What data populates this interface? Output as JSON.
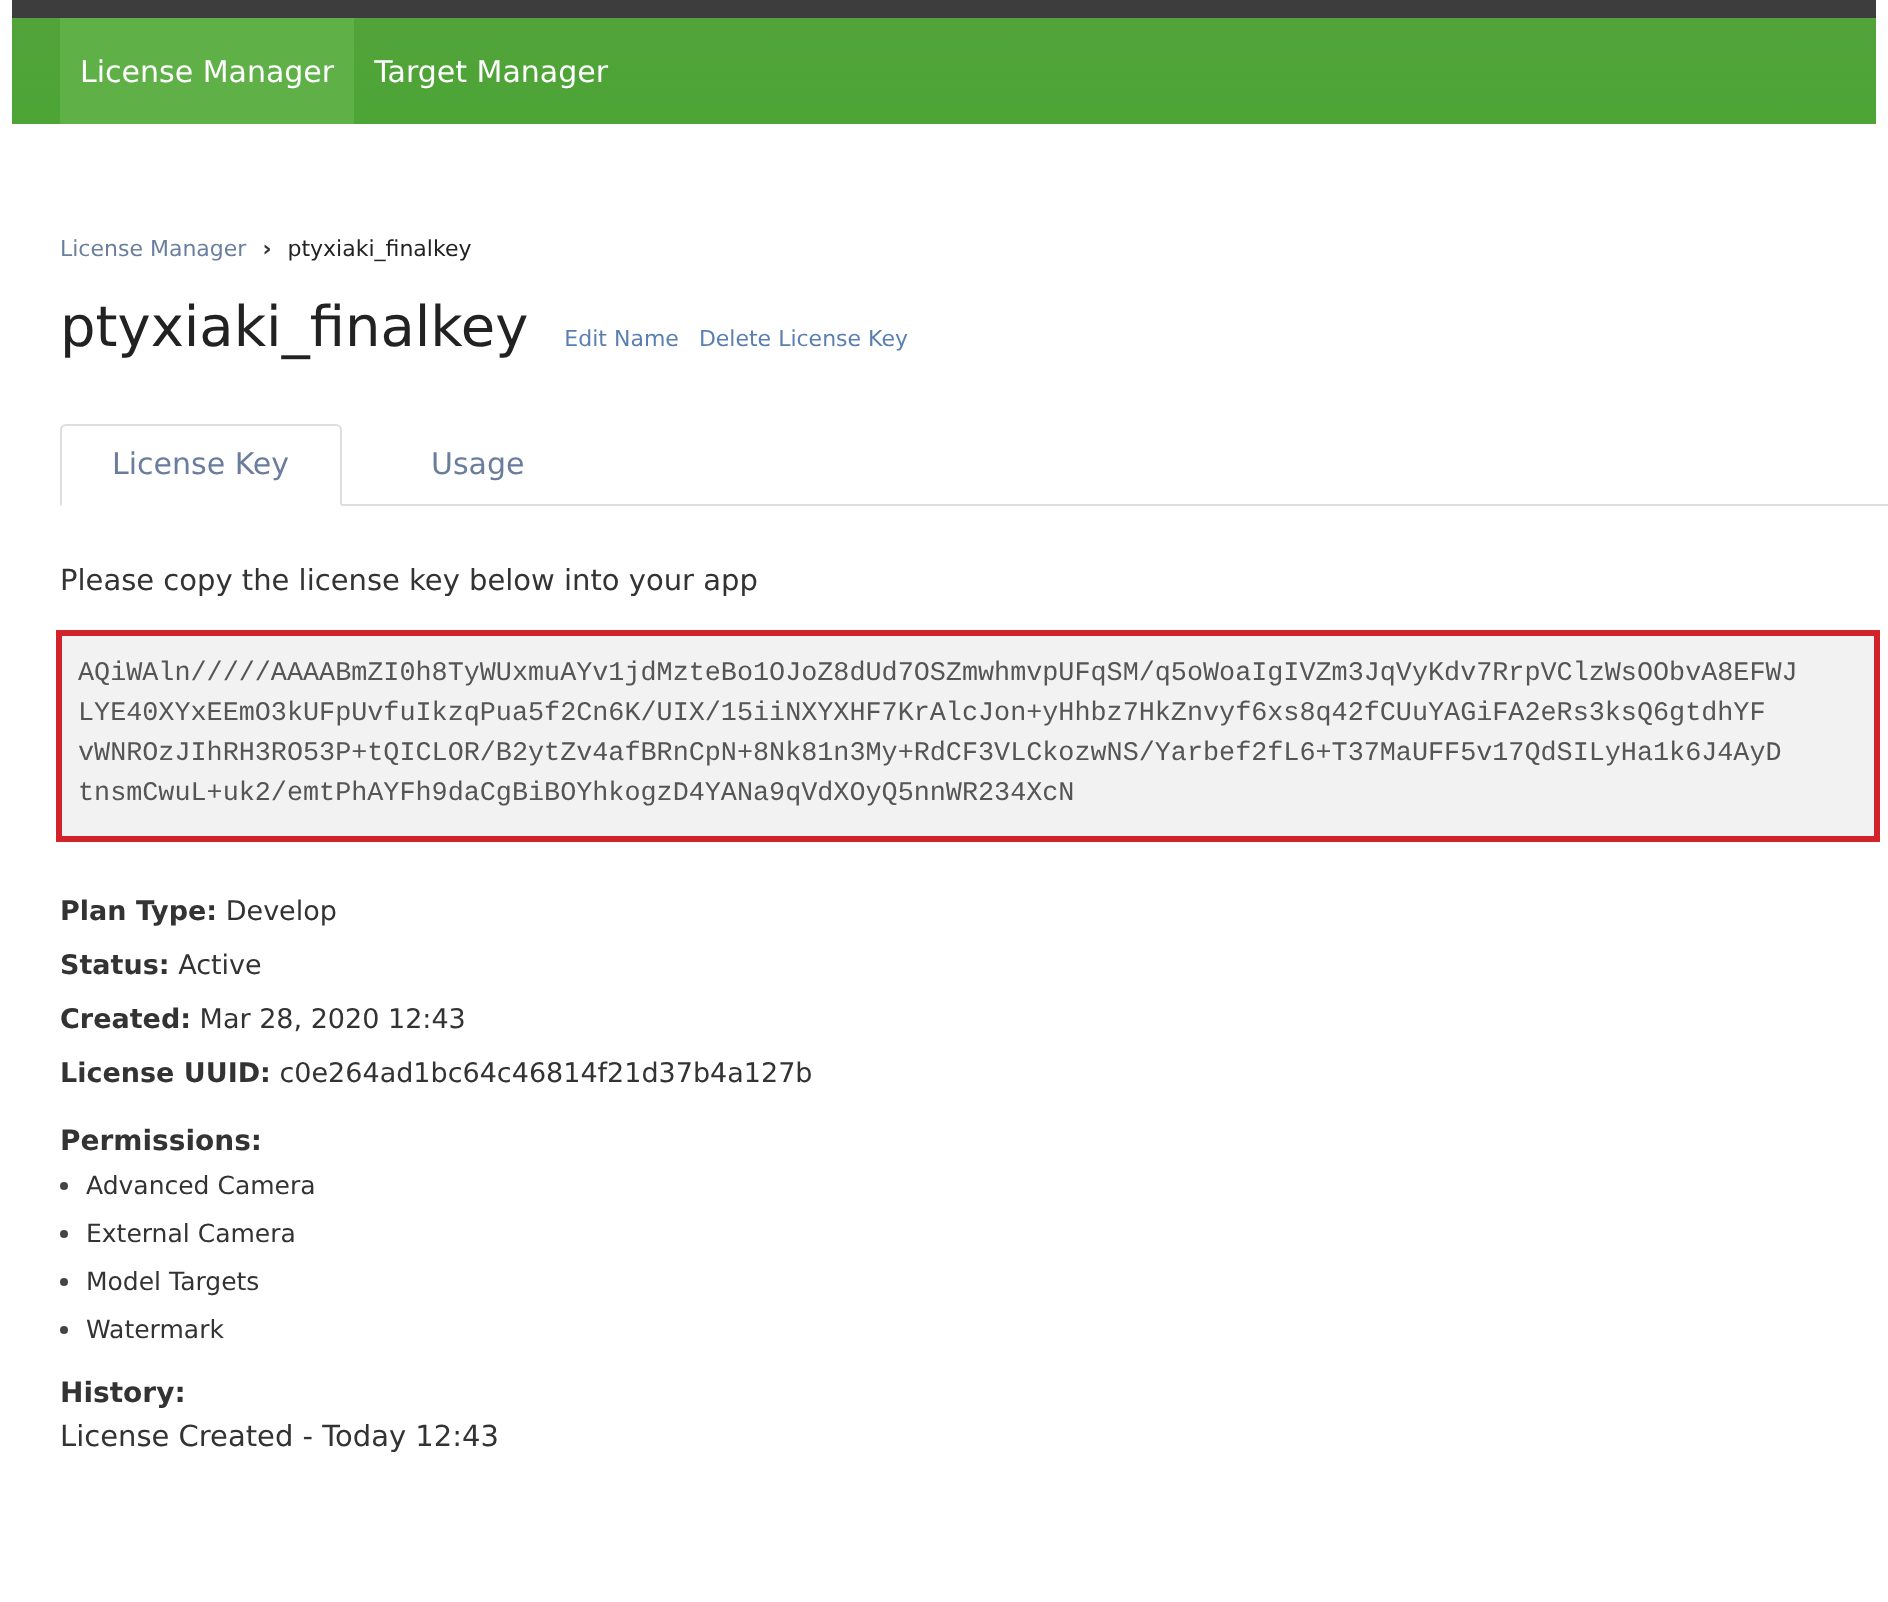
{
  "nav": [
    {
      "label": "License Manager",
      "selected": true
    },
    {
      "label": "Target Manager",
      "selected": false
    }
  ],
  "breadcrumb": {
    "link": "License Manager",
    "separator": "›",
    "current": "ptyxiaki_finalkey"
  },
  "title": "ptyxiaki_finalkey",
  "title_actions": [
    "Edit Name",
    "Delete License Key"
  ],
  "tabs": [
    {
      "label": "License Key",
      "selected": true
    },
    {
      "label": "Usage",
      "selected": false
    }
  ],
  "instruction": "Please copy the license key below into your app",
  "license_key": "AQiWAln/////AAAABmZI0h8TyWUxmuAYv1jdMzteBo1OJoZ8dUd7OSZmwhmvpUFqSM/q5oWoaIgIVZm3JqVyKdv7RrpVClzWsOObvA8EFWJ\nLYE40XYxEEmO3kUFpUvfuIkzqPua5f2Cn6K/UIX/15iiNXYXHF7KrAlcJon+yHhbz7HkZnvyf6xs8q42fCUuYAGiFA2eRs3ksQ6gtdhYF\nvWNROzJIhRH3RO53P+tQICLOR/B2ytZv4afBRnCpN+8Nk81n3My+RdCF3VLCkozwNS/Yarbef2fL6+T37MaUFF5v17QdSILyHa1k6J4AyD\ntnsmCwuL+uk2/emtPhAYFh9daCgBiBOYhkogzD4YANa9qVdXOyQ5nnWR234XcN",
  "details": [
    {
      "label": "Plan Type:",
      "value": "Develop"
    },
    {
      "label": "Status:",
      "value": "Active"
    },
    {
      "label": "Created:",
      "value": "Mar 28, 2020 12:43"
    },
    {
      "label": "License UUID:",
      "value": "c0e264ad1bc64c46814f21d37b4a127b"
    }
  ],
  "permissions": {
    "heading": "Permissions:",
    "items": [
      "Advanced Camera",
      "External Camera",
      "Model Targets",
      "Watermark"
    ]
  },
  "history": {
    "heading": "History:",
    "items": [
      "License Created - Today 12:43"
    ]
  }
}
